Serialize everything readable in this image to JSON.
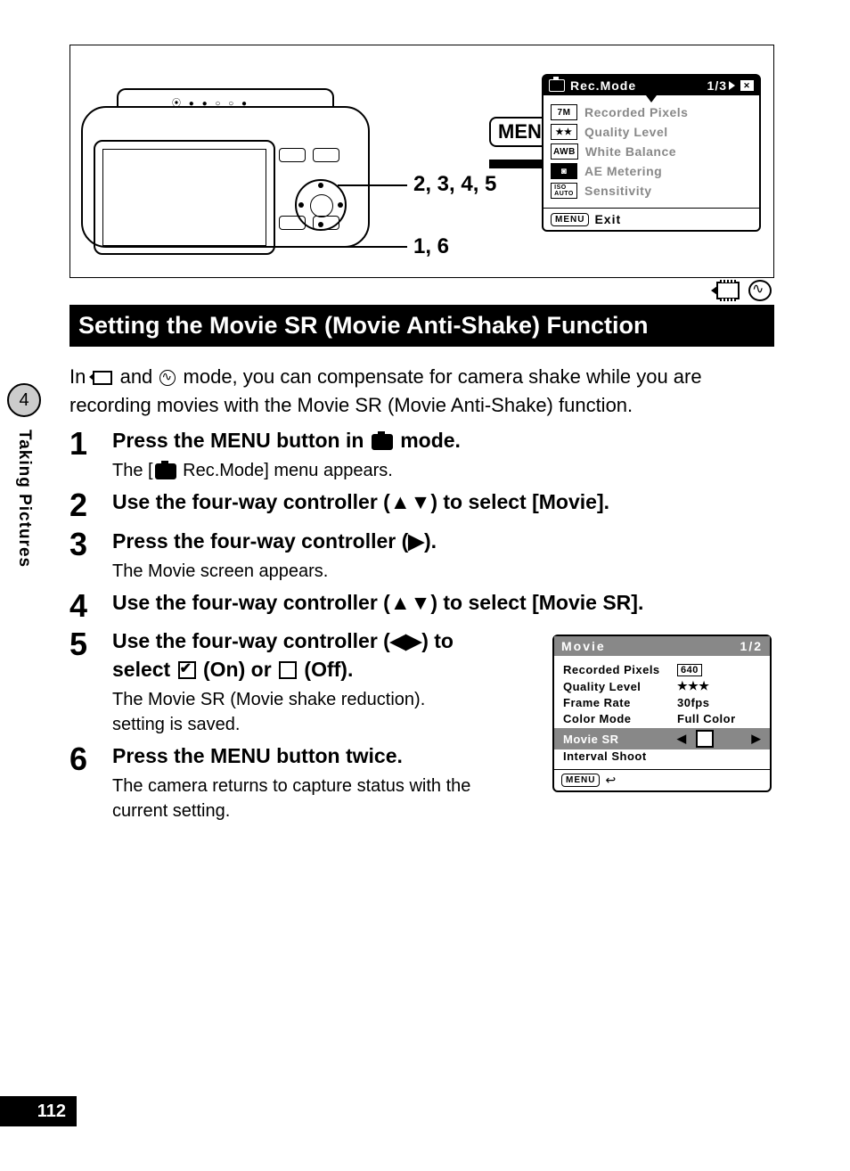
{
  "sidebar": {
    "chapter_number": "4",
    "chapter_title": "Taking Pictures"
  },
  "page_number": "112",
  "diagram": {
    "menu_badge": "MENU",
    "callout_steps_a": "2, 3, 4, 5",
    "callout_steps_b": "1, 6"
  },
  "rec_mode_menu": {
    "title": "Rec.Mode",
    "page_indicator": "1/3",
    "items": [
      {
        "tag": "7M",
        "label": "Recorded Pixels"
      },
      {
        "tag": "★★",
        "label": "Quality Level"
      },
      {
        "tag": "AWB",
        "label": "White Balance"
      },
      {
        "tag": "◙",
        "label": "AE Metering"
      },
      {
        "tag": "ISO\nAUTO",
        "label": "Sensitivity"
      }
    ],
    "footer_menu": "MENU",
    "footer_exit": "Exit"
  },
  "heading": "Setting the Movie SR (Movie Anti-Shake) Function",
  "intro_before": "In ",
  "intro_mid": " and ",
  "intro_after": " mode, you can compensate for camera shake while you are recording movies with the Movie SR (Movie Anti-Shake) function.",
  "steps": {
    "s1": {
      "num": "1",
      "title_a": "Press the ",
      "title_menu": "MENU",
      "title_b": " button in ",
      "title_c": " mode.",
      "sub_a": "The [",
      "sub_b": " Rec.Mode] menu appears."
    },
    "s2": {
      "num": "2",
      "title": "Use the four-way controller (▲▼) to select [Movie]."
    },
    "s3": {
      "num": "3",
      "title": "Press the four-way controller (▶).",
      "sub": "The Movie screen appears."
    },
    "s4": {
      "num": "4",
      "title": "Use the four-way controller (▲▼) to select [Movie SR]."
    },
    "s5": {
      "num": "5",
      "title_a": "Use the four-way controller (◀▶) to select ",
      "title_on": " (On) or ",
      "title_off": " (Off).",
      "sub": "The Movie SR (Movie shake reduction). setting is saved."
    },
    "s6": {
      "num": "6",
      "title_a": "Press the ",
      "title_menu": "MENU",
      "title_b": " button twice.",
      "sub": "The camera returns to capture status with the current setting."
    }
  },
  "movie_menu": {
    "title": "Movie",
    "page_indicator": "1/2",
    "rows": {
      "recorded_pixels_k": "Recorded Pixels",
      "recorded_pixels_v": "640",
      "quality_k": "Quality Level",
      "quality_v": "★★★",
      "frame_k": "Frame Rate",
      "frame_v": "30fps",
      "color_k": "Color Mode",
      "color_v": "Full Color",
      "moviesr_k": "Movie SR",
      "interval_k": "Interval Shoot"
    },
    "footer_menu": "MENU"
  }
}
